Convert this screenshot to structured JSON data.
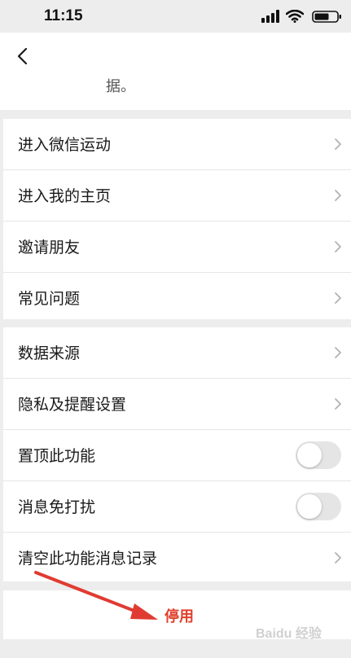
{
  "status": {
    "time": "11:15"
  },
  "header": {
    "text": "据。"
  },
  "group1": [
    {
      "label": "进入微信运动"
    },
    {
      "label": "进入我的主页"
    },
    {
      "label": "邀请朋友"
    },
    {
      "label": "常见问题"
    }
  ],
  "group2": [
    {
      "label": "数据来源",
      "type": "link"
    },
    {
      "label": "隐私及提醒设置",
      "type": "link"
    },
    {
      "label": "置顶此功能",
      "type": "toggle",
      "value": false
    },
    {
      "label": "消息免打扰",
      "type": "toggle",
      "value": false
    },
    {
      "label": "清空此功能消息记录",
      "type": "link"
    }
  ],
  "disable": {
    "label": "停用"
  },
  "watermark": {
    "text": "Baidu 经验"
  },
  "colors": {
    "accent": "#e0402c",
    "background": "#ededed"
  }
}
